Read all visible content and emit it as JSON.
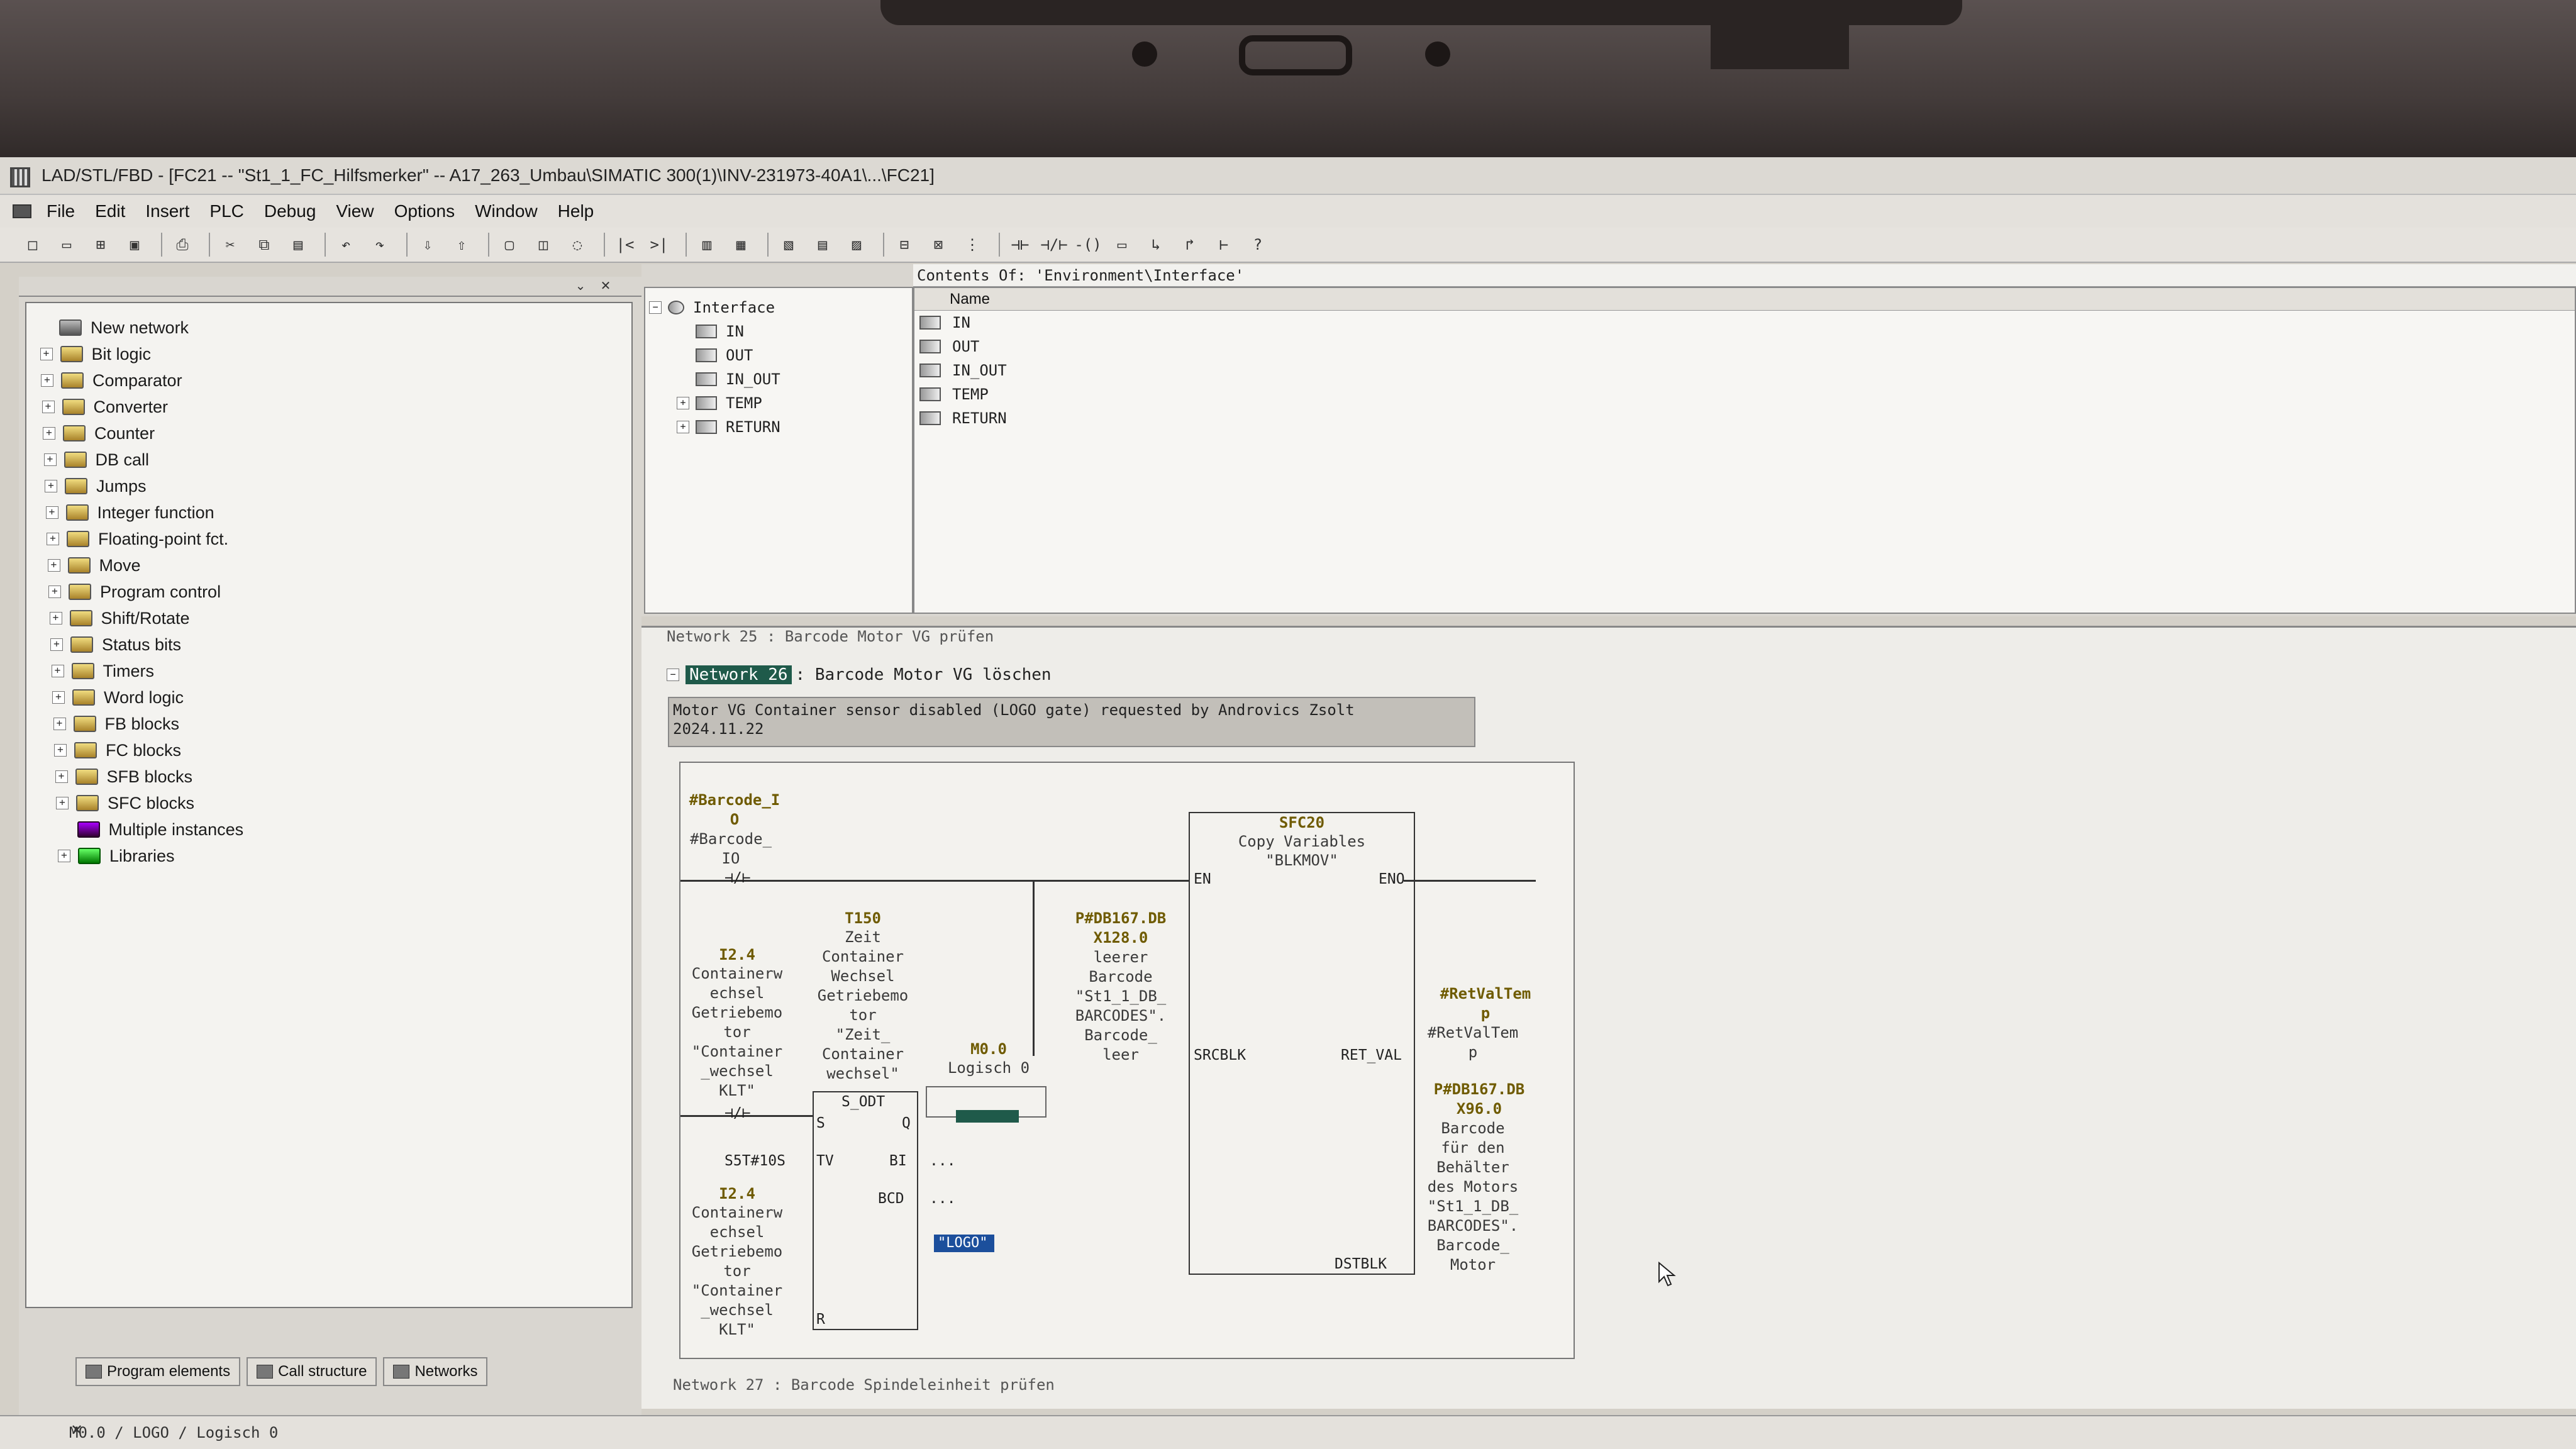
{
  "window": {
    "title": "LAD/STL/FBD  - [FC21 -- \"St1_1_FC_Hilfsmerker\" -- A17_263_Umbau\\SIMATIC 300(1)\\INV-231973-40A1\\...\\FC21]"
  },
  "menu": [
    "File",
    "Edit",
    "Insert",
    "PLC",
    "Debug",
    "View",
    "Options",
    "Window",
    "Help"
  ],
  "toolbar": {
    "buttons": [
      "new-icon",
      "open-icon",
      "accessible-nodes-icon",
      "save-icon",
      "print-icon",
      "cut-icon",
      "copy-icon",
      "paste-icon",
      "undo-icon",
      "redo-icon",
      "download-icon",
      "upload-icon",
      "display-icon",
      "monitor-icon",
      "compare-icon",
      "first-icon",
      "last-icon",
      "overview-icon",
      "detail-icon",
      "table-icon",
      "lad-icon",
      "stl-icon",
      "fbd-icon",
      "network-icon",
      "branch-icon",
      "no-contact-icon",
      "nc-contact-icon",
      "coil-icon",
      "box-icon",
      "open-branch-icon",
      "close-branch-icon",
      "connection-icon",
      "help-icon"
    ]
  },
  "program_elements": {
    "items": [
      {
        "label": "New network",
        "icon": "network-icon",
        "expand": false
      },
      {
        "label": "Bit logic",
        "icon": "folder-icon",
        "expand": true
      },
      {
        "label": "Comparator",
        "icon": "folder-icon",
        "expand": true
      },
      {
        "label": "Converter",
        "icon": "folder-icon",
        "expand": true
      },
      {
        "label": "Counter",
        "icon": "folder-icon",
        "expand": true
      },
      {
        "label": "DB call",
        "icon": "folder-icon",
        "expand": true
      },
      {
        "label": "Jumps",
        "icon": "folder-icon",
        "expand": true
      },
      {
        "label": "Integer function",
        "icon": "folder-icon",
        "expand": true
      },
      {
        "label": "Floating-point fct.",
        "icon": "folder-icon",
        "expand": true
      },
      {
        "label": "Move",
        "icon": "folder-icon",
        "expand": true
      },
      {
        "label": "Program control",
        "icon": "folder-icon",
        "expand": true
      },
      {
        "label": "Shift/Rotate",
        "icon": "folder-icon",
        "expand": true
      },
      {
        "label": "Status bits",
        "icon": "folder-icon",
        "expand": true
      },
      {
        "label": "Timers",
        "icon": "folder-icon",
        "expand": true
      },
      {
        "label": "Word logic",
        "icon": "folder-icon",
        "expand": true
      },
      {
        "label": "FB blocks",
        "icon": "folder-icon",
        "expand": true
      },
      {
        "label": "FC blocks",
        "icon": "folder-icon",
        "expand": true
      },
      {
        "label": "SFB blocks",
        "icon": "folder-icon",
        "expand": true
      },
      {
        "label": "SFC blocks",
        "icon": "folder-icon",
        "expand": true
      },
      {
        "label": "Multiple instances",
        "icon": "instance-icon",
        "expand": false
      },
      {
        "label": "Libraries",
        "icon": "library-icon",
        "expand": true
      }
    ],
    "tabs": [
      "Program elements",
      "Call structure",
      "Networks"
    ]
  },
  "interface": {
    "tree_root": "Interface",
    "tree": [
      {
        "label": "IN",
        "expand": false
      },
      {
        "label": "OUT",
        "expand": false
      },
      {
        "label": "IN_OUT",
        "expand": false
      },
      {
        "label": "TEMP",
        "expand": true
      },
      {
        "label": "RETURN",
        "expand": true
      }
    ],
    "contents_title": "Contents Of: 'Environment\\Interface'",
    "column_name": "Name",
    "rows": [
      "IN",
      "OUT",
      "IN_OUT",
      "TEMP",
      "RETURN"
    ]
  },
  "editor": {
    "network25": "Network 25 : Barcode Motor VG prüfen",
    "network26_label": "Network 26",
    "network26_title": ": Barcode Motor VG löschen",
    "comment": "Motor VG Container sensor disabled (LOGO gate) requested by Androvics Zsolt\n2024.11.22",
    "network27": "Network 27 : Barcode Spindeleinheit prüfen",
    "ladder": {
      "barcode_op": "#Barcode_I\nO",
      "barcode_sym": "#Barcode_\nIO",
      "i24_op": "I2.4",
      "i24_desc": "Containerw\nechsel\nGetriebemo\ntor\n\"Container\n_wechsel\nKLT\"",
      "t150_op": "T150",
      "t150_desc": "Zeit\nContainer\nWechsel\nGetriebemo\ntor\n\"Zeit_\nContainer\nwechsel\"",
      "timer_type": "S_ODT",
      "pin_s": "S",
      "pin_q": "Q",
      "pin_tv": "TV",
      "pin_bi": "BI",
      "pin_bcd": "BCD",
      "pin_r": "R",
      "tv_value": "S5T#10S",
      "bi_value": "...",
      "bcd_value": "...",
      "i24_r_op": "I2.4",
      "i24_r_desc": "Containerw\nechsel\nGetriebemo\ntor\n\"Container\n_wechsel\nKLT\"",
      "m00_op": "M0.0",
      "m00_desc": "Logisch 0",
      "m00_sym": "\"LOGO\"",
      "srcblk_op": "P#DB167.DB\nX128.0",
      "srcblk_desc": "leerer\nBarcode\n\"St1_1_DB_\nBARCODES\".\nBarcode_\nleer",
      "sfc_name": "SFC20",
      "sfc_desc": "Copy Variables",
      "sfc_sym": "\"BLKMOV\"",
      "pin_en": "EN",
      "pin_eno": "ENO",
      "pin_srcblk": "SRCBLK",
      "pin_retval": "RET_VAL",
      "pin_dstblk": "DSTBLK",
      "retval_op": "#RetValTem\np",
      "retval_sym": "#RetValTem\np",
      "dst_op": "P#DB167.DB\nX96.0",
      "dst_desc": "Barcode\nfür den\nBehälter\ndes Motors\n\"St1_1_DB_\nBARCODES\".\nBarcode_\nMotor"
    }
  },
  "status": {
    "text": "M0.0 / LOGO / Logisch 0"
  }
}
